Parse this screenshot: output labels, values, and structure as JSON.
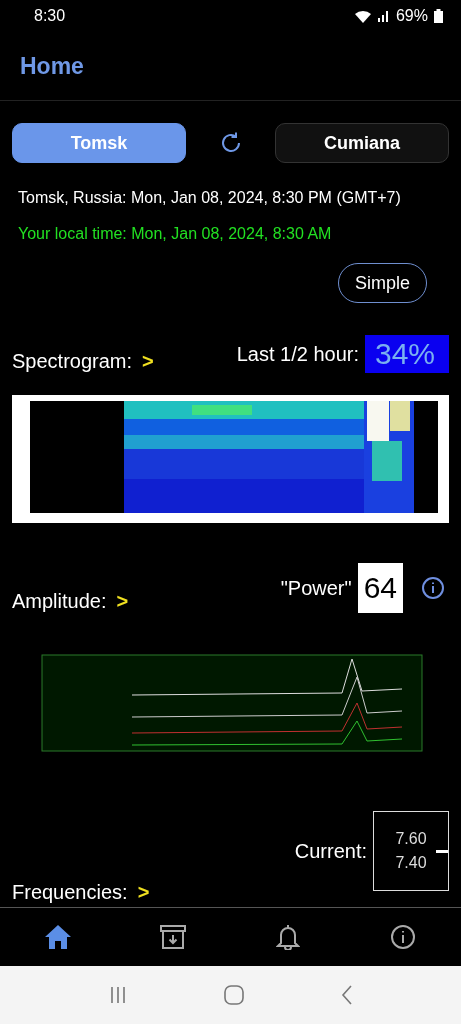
{
  "status_bar": {
    "time": "8:30",
    "battery": "69%"
  },
  "header": {
    "title": "Home"
  },
  "stations": [
    {
      "label": "Tomsk",
      "selected": true
    },
    {
      "label": "Cumiana",
      "selected": false
    }
  ],
  "station_time": "Tomsk, Russia: Mon, Jan 08, 2024, 8:30 PM (GMT+7)",
  "local_time": "Your local time: Mon, Jan 08, 2024, 8:30 AM",
  "mode_button": "Simple",
  "spectrogram": {
    "label": "Spectrogram:",
    "chevron": ">",
    "last_label": "Last 1/2 hour:",
    "last_value": "34%"
  },
  "amplitude": {
    "label": "Amplitude:",
    "chevron": ">",
    "power_label": "\"Power\"",
    "power_value": "64"
  },
  "frequencies": {
    "label": "Frequencies:",
    "chevron": ">",
    "current_label": "Current:",
    "scale": [
      "7.60",
      "7.40"
    ]
  },
  "bottom_nav": [
    {
      "kind": "home",
      "selected": true
    },
    {
      "kind": "archive",
      "selected": false
    },
    {
      "kind": "bell",
      "selected": false
    },
    {
      "kind": "info",
      "selected": false
    }
  ]
}
